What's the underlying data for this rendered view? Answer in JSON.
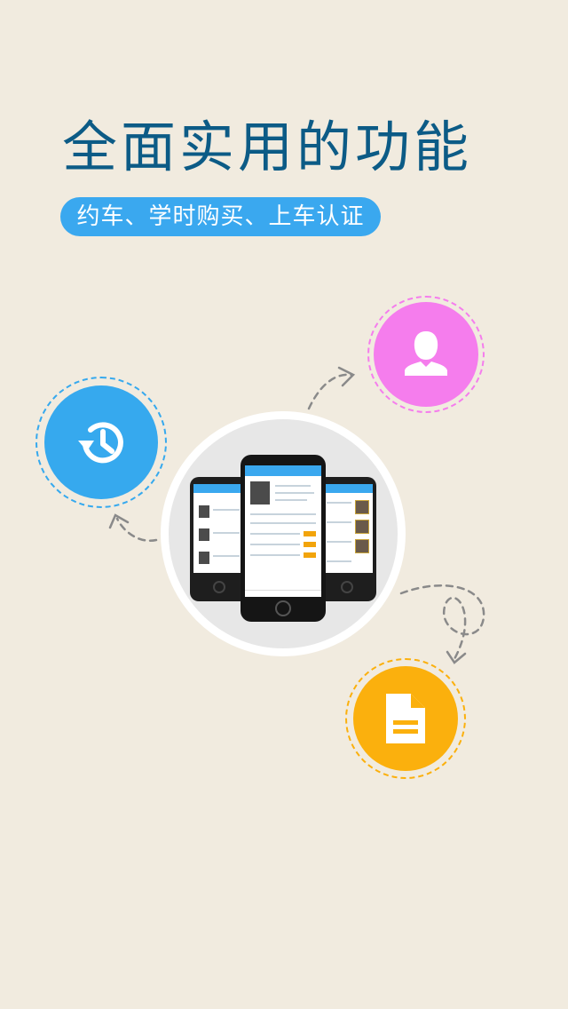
{
  "header": {
    "title": "全面实用的功能",
    "subtitle": "约车、学时购买、上车认证"
  },
  "features": [
    {
      "name": "history",
      "icon": "history-icon",
      "color": "#36a9ee"
    },
    {
      "name": "user",
      "icon": "user-icon",
      "color": "#f57ded"
    },
    {
      "name": "document",
      "icon": "document-icon",
      "color": "#fbb00d"
    }
  ],
  "colors": {
    "background": "#f1ebdf",
    "title": "#0c5b86",
    "pill": "#3aa8ef"
  }
}
